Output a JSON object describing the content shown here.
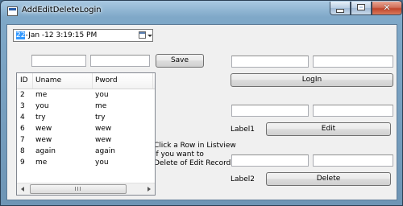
{
  "window": {
    "title": "AddEditDeleteLogin",
    "close_glyph": "✕"
  },
  "datepicker": {
    "day_selected": "22",
    "rest": "-Jan -12   3:19:15 PM",
    "icon": "calendar-icon"
  },
  "buttons": {
    "save": "Save",
    "login": "LogIn",
    "edit": "Edit",
    "delete": "Delete"
  },
  "labels": {
    "label1": "Label1",
    "label2": "Label2",
    "instruction_line1": "Click a Row in Listview",
    "instruction_line2": "if you want to",
    "instruction_line3": "Delete of Edit Record"
  },
  "listview": {
    "columns": [
      "ID",
      "Uname",
      "Pword"
    ],
    "rows": [
      {
        "id": "2",
        "uname": "me",
        "pword": "you"
      },
      {
        "id": "3",
        "uname": "you",
        "pword": "me"
      },
      {
        "id": "4",
        "uname": "try",
        "pword": "try"
      },
      {
        "id": "6",
        "uname": "wew",
        "pword": "wew"
      },
      {
        "id": "7",
        "uname": "wew",
        "pword": "wew"
      },
      {
        "id": "8",
        "uname": "again",
        "pword": "again"
      },
      {
        "id": "9",
        "uname": "me",
        "pword": "you"
      }
    ],
    "scroll_thumb_grip": "III"
  }
}
